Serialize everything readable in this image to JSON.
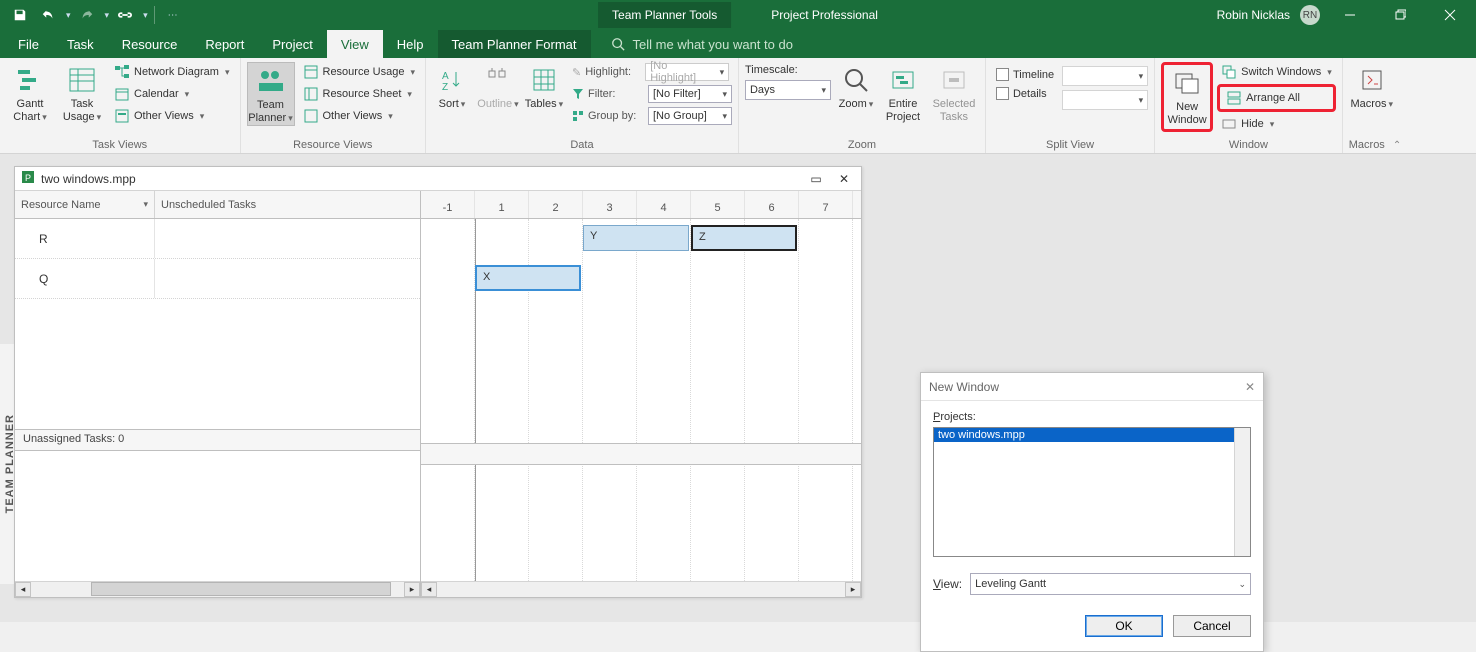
{
  "titlebar": {
    "app_title": "Project Professional",
    "context_title": "Team Planner Tools",
    "user_name": "Robin Nicklas",
    "user_initials": "RN"
  },
  "tabs": {
    "file": "File",
    "task": "Task",
    "resource": "Resource",
    "report": "Report",
    "project": "Project",
    "view": "View",
    "help": "Help",
    "format": "Team Planner Format",
    "tellme": "Tell me what you want to do"
  },
  "ribbon": {
    "task_views": {
      "label": "Task Views",
      "gantt": "Gantt Chart",
      "usage": "Task Usage",
      "network": "Network Diagram",
      "calendar": "Calendar",
      "other": "Other Views"
    },
    "resource_views": {
      "label": "Resource Views",
      "team": "Team Planner",
      "res_usage": "Resource Usage",
      "res_sheet": "Resource Sheet",
      "other": "Other Views"
    },
    "data": {
      "label": "Data",
      "sort": "Sort",
      "outline": "Outline",
      "tables": "Tables",
      "highlight_lbl": "Highlight:",
      "highlight_val": "[No Highlight]",
      "filter_lbl": "Filter:",
      "filter_val": "[No Filter]",
      "group_lbl": "Group by:",
      "group_val": "[No Group]"
    },
    "zoom": {
      "label": "Zoom",
      "timescale_lbl": "Timescale:",
      "timescale_val": "Days",
      "zoom": "Zoom",
      "entire": "Entire Project",
      "selected": "Selected Tasks"
    },
    "split": {
      "label": "Split View",
      "timeline": "Timeline",
      "details": "Details"
    },
    "window": {
      "label": "Window",
      "new": "New Window",
      "switch": "Switch Windows",
      "arrange": "Arrange All",
      "hide": "Hide"
    },
    "macros": {
      "label": "Macros",
      "macros": "Macros"
    }
  },
  "document": {
    "filename": "two windows.mpp",
    "side_label": "TEAM PLANNER",
    "col_resource": "Resource Name",
    "col_unscheduled": "Unscheduled Tasks",
    "unassigned": "Unassigned Tasks: 0",
    "resources": [
      "R",
      "Q"
    ],
    "time_cols": [
      "-1",
      "1",
      "2",
      "3",
      "4",
      "5",
      "6",
      "7"
    ],
    "tasks": {
      "Y": "Y",
      "Z": "Z",
      "X": "X"
    }
  },
  "dialog": {
    "title": "New Window",
    "projects_lbl": "Projects:",
    "project_item": "two windows.mpp",
    "view_lbl": "View:",
    "view_val": "Leveling Gantt",
    "ok": "OK",
    "cancel": "Cancel"
  }
}
